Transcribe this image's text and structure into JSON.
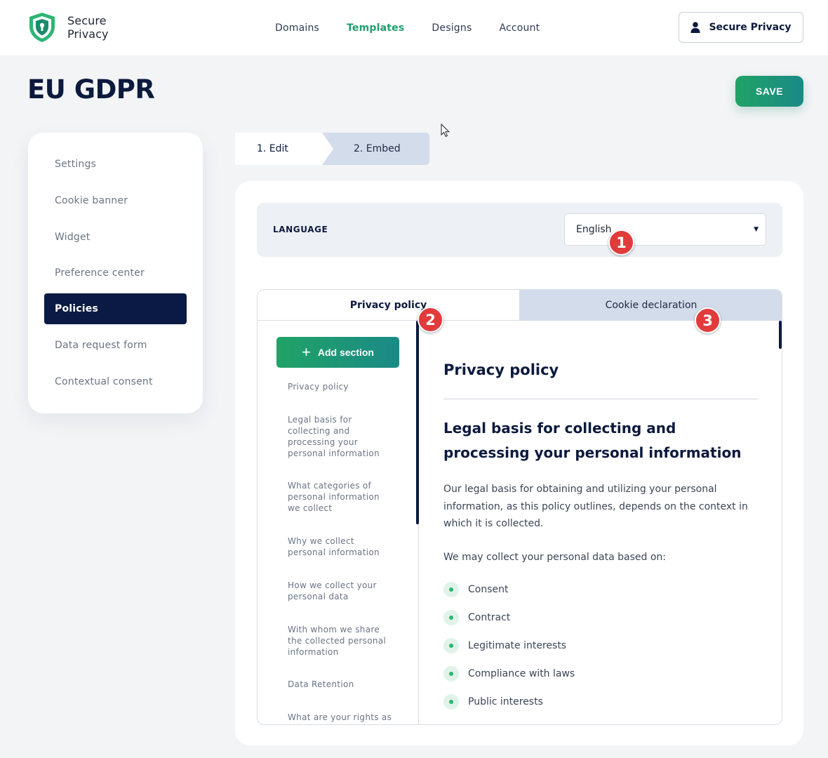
{
  "header": {
    "logo_line1": "Secure",
    "logo_line2": "Privacy",
    "nav": [
      "Domains",
      "Templates",
      "Designs",
      "Account"
    ],
    "active_nav": "Templates",
    "account_label": "Secure Privacy"
  },
  "page": {
    "title": "EU GDPR",
    "save_label": "SAVE"
  },
  "sidebar": {
    "items": [
      {
        "label": "Settings"
      },
      {
        "label": "Cookie banner"
      },
      {
        "label": "Widget"
      },
      {
        "label": "Preference center"
      },
      {
        "label": "Policies",
        "active": true
      },
      {
        "label": "Data request form"
      },
      {
        "label": "Contextual consent"
      }
    ]
  },
  "steps": {
    "edit": "1. Edit",
    "embed": "2. Embed"
  },
  "language": {
    "label": "LANGUAGE",
    "selected": "English"
  },
  "tabs": {
    "privacy": "Privacy policy",
    "cookie": "Cookie declaration"
  },
  "sections": {
    "add_label": "Add section",
    "items": [
      "Privacy policy",
      "Legal basis for collecting and processing your personal information",
      "What categories of personal information we collect",
      "Why we collect personal information",
      "How we collect your personal data",
      "With whom we share the collected personal information",
      "Data Retention",
      "What are your rights as"
    ]
  },
  "preview": {
    "title": "Privacy policy",
    "heading": "Legal basis for collecting and processing your personal information",
    "para1": "Our legal basis for obtaining and utilizing your personal information, as this policy outlines, depends on the context in which it is collected.",
    "para2": "We may collect your personal data based on:",
    "bullets": [
      "Consent",
      "Contract",
      "Legitimate interests",
      "Compliance with laws",
      "Public interests"
    ]
  },
  "badges": [
    "1",
    "2",
    "3"
  ],
  "colors": {
    "brand_green": "#21a267",
    "navy": "#0a1a44",
    "badge_red": "#e23b3b",
    "tab_inactive": "#d3dcea"
  },
  "icons": {
    "logo": "shield-lock-icon",
    "account": "user-icon",
    "language_caret": "caret-down-icon",
    "add": "plus-icon",
    "cursor": "mouse-pointer-icon"
  }
}
